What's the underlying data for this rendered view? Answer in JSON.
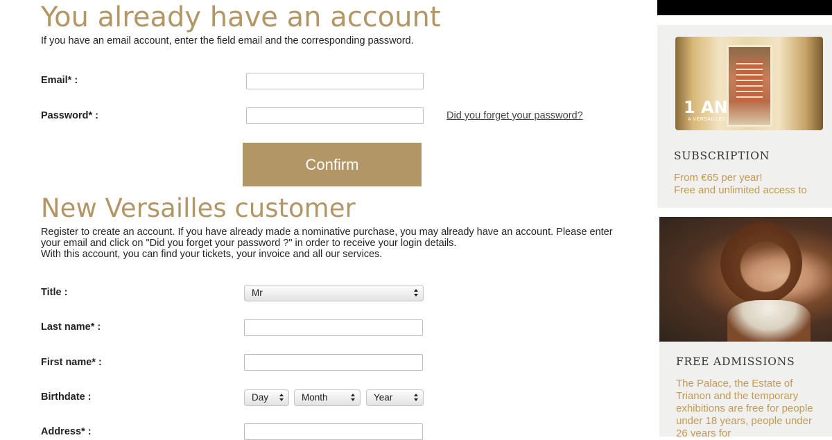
{
  "login": {
    "title": "You already have an account",
    "intro": "If you have an email account, enter the field email and the corresponding password.",
    "email_label": "Email* :",
    "password_label": "Password* :",
    "forgot_link": "Did you forget your password?",
    "confirm_label": "Confirm"
  },
  "register": {
    "title": "New Versailles customer",
    "intro_line1": "Register to create an account. If you have already made a nominative purchase, you may already have an account. Please enter your email and click on \"Did you forget your password ?\" in order to receive your login details.",
    "intro_line2": "With this account, you can find your tickets, your invoice and all our services.",
    "title_label": "Title :",
    "title_value": "Mr",
    "lastname_label": "Last name* :",
    "firstname_label": "First name* :",
    "birthdate_label": "Birthdate :",
    "day_value": "Day",
    "month_value": "Month",
    "year_value": "Year",
    "address_label": "Address* :"
  },
  "sidebar": {
    "card1": {
      "image_text": "1 AN",
      "image_subtext": "A VERSAILLES",
      "title": "SUBSCRIPTION",
      "text_line1": "From €65 per year!",
      "text_line2": "Free and unlimited access to"
    },
    "card2": {
      "title": "FREE ADMISSIONS",
      "text": "The Palace, the Estate of Trianon and the temporary exhibitions are free for people under 18 years, people under 26 years for"
    }
  },
  "colors": {
    "accent": "#b39665",
    "sidebar_text": "#c19a55",
    "sidebar_bg": "#f0f0ef"
  }
}
